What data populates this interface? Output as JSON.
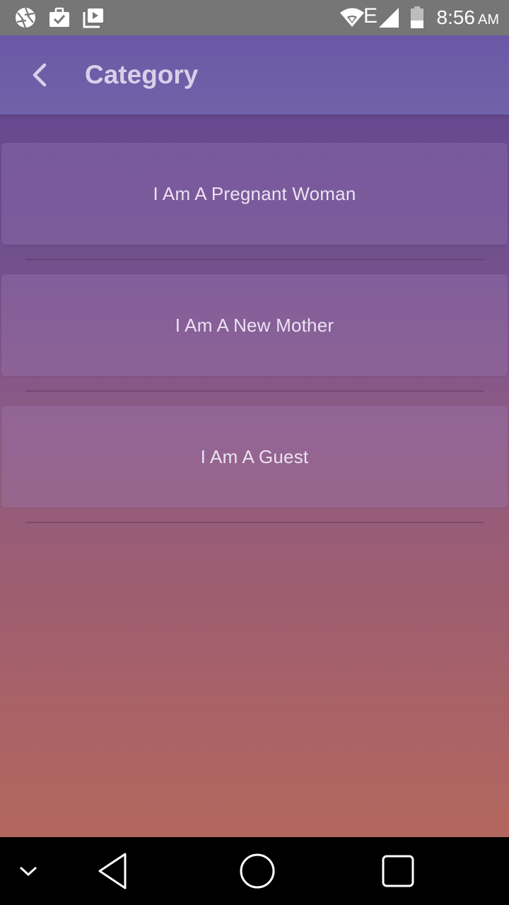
{
  "status_bar": {
    "time": "8:56",
    "ampm": "AM",
    "network_label": "E",
    "icons": [
      "aperture-icon",
      "briefcase-check-icon",
      "video-library-icon",
      "wifi-icon",
      "signal-icon",
      "battery-icon"
    ]
  },
  "app_bar": {
    "title": "Category",
    "back_icon": "chevron-left-icon"
  },
  "categories": [
    {
      "label": "I Am A Pregnant Woman"
    },
    {
      "label": "I Am A New Mother"
    },
    {
      "label": "I Am A Guest"
    }
  ],
  "nav_bar": {
    "icons": [
      "chevron-down-icon",
      "back-triangle-icon",
      "home-circle-icon",
      "recents-square-icon"
    ]
  },
  "colors": {
    "status_bar": "#767676",
    "app_bar": "#6b58a5",
    "title_text": "#d9cfe9",
    "card_text": "#ece2f2",
    "gradient_top": "#5f4693",
    "gradient_bottom": "#b86a5a"
  }
}
